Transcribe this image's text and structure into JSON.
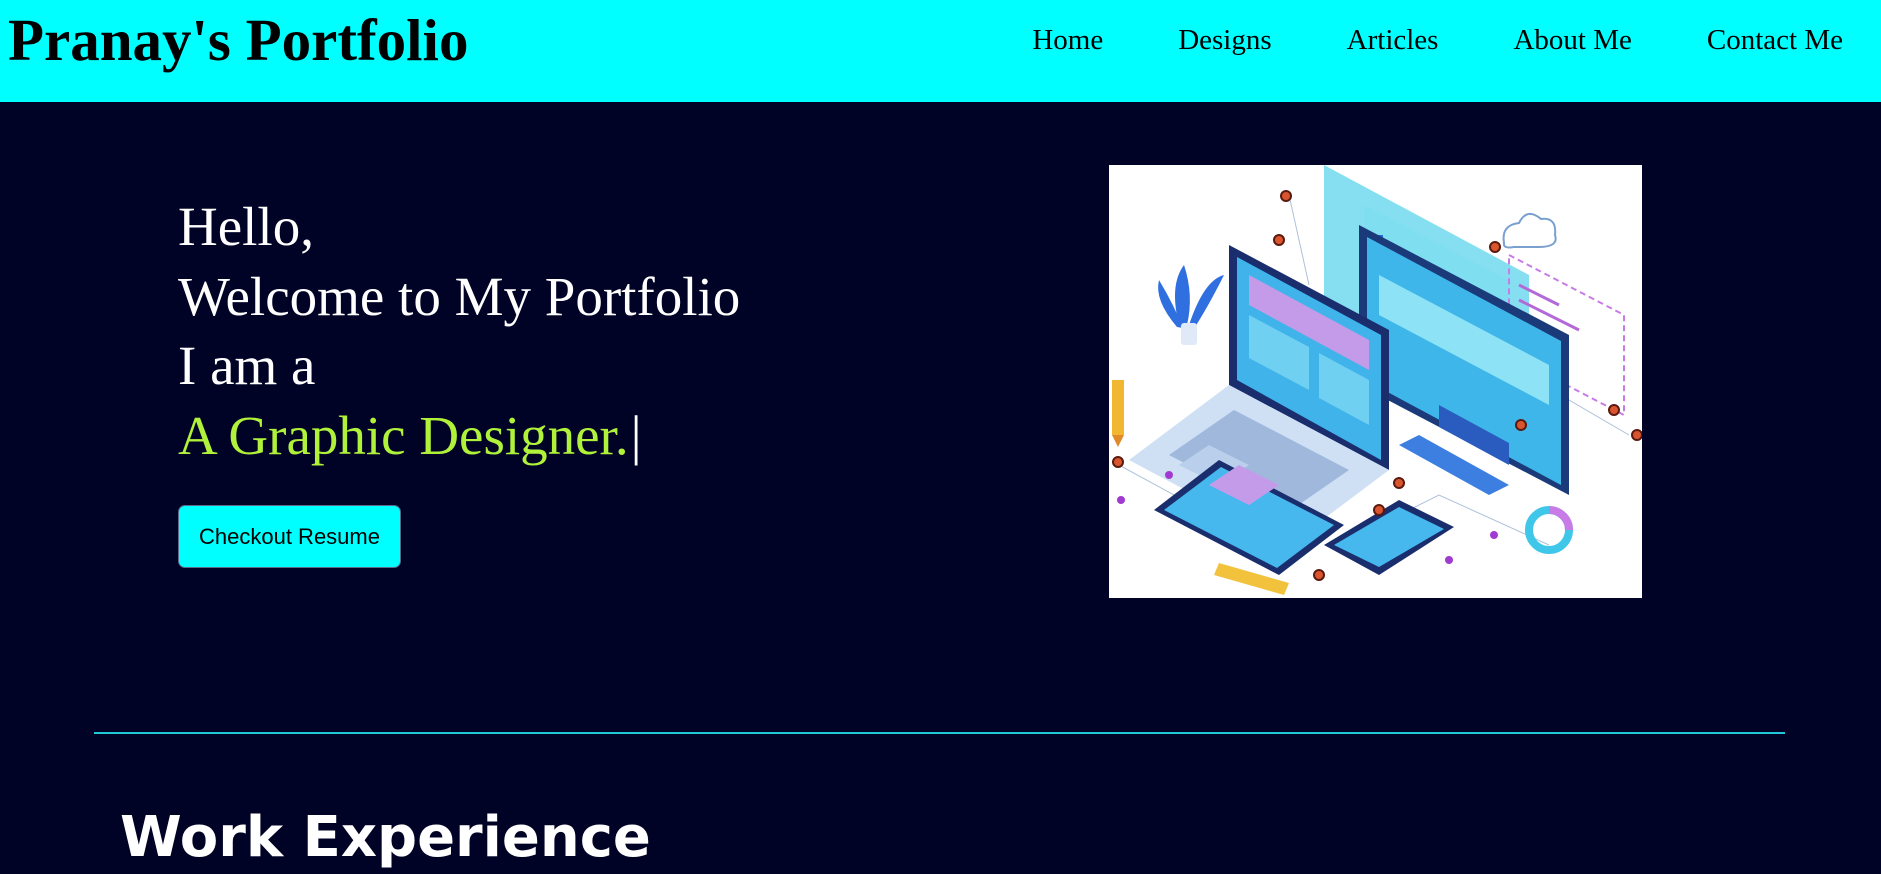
{
  "brand": {
    "title": "Pranay's Portfolio"
  },
  "nav": {
    "items": [
      {
        "label": "Home"
      },
      {
        "label": "Designs"
      },
      {
        "label": "Articles"
      },
      {
        "label": "About Me"
      },
      {
        "label": "Contact Me"
      }
    ]
  },
  "hero": {
    "greeting": "Hello,",
    "welcome": "Welcome to My Portfolio",
    "intro": "I am a",
    "role": "A Graphic Designer.",
    "cursor": "|",
    "resume_button": "Checkout Resume",
    "image_icon": "devices-illustration-icon"
  },
  "sections": {
    "work_experience_title": "Work Experience"
  },
  "colors": {
    "navbar": "#00ffff",
    "background": "#010326",
    "role_text": "#b0f23a",
    "button": "#00ffff",
    "divider": "#1ec8d6"
  }
}
